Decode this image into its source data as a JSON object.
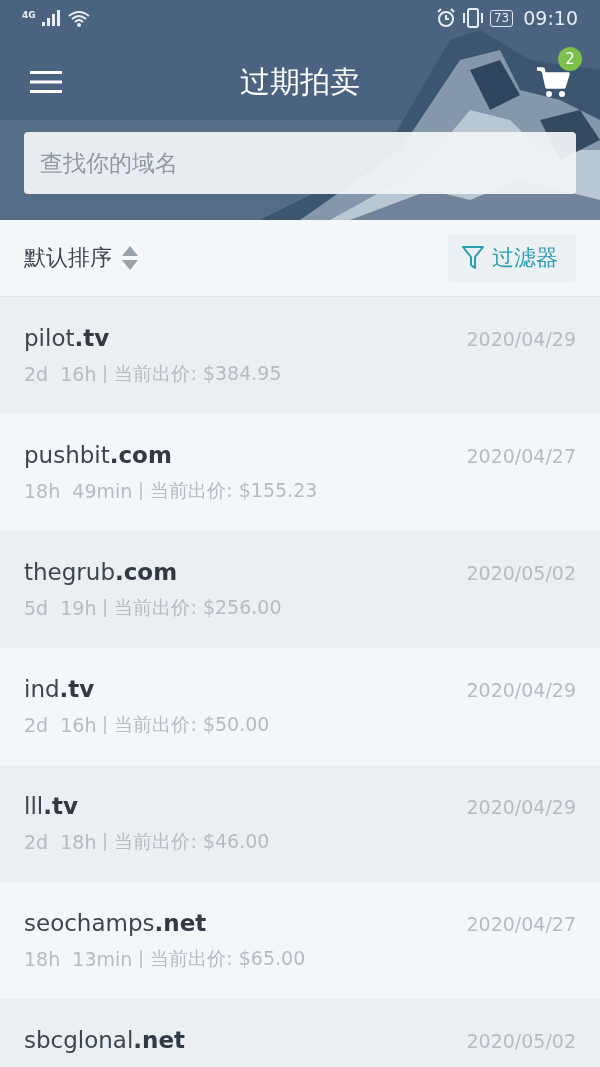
{
  "status_bar": {
    "network": "4G",
    "battery": "73",
    "time": "09:10"
  },
  "header": {
    "title": "过期拍卖",
    "cart_count": "2"
  },
  "search": {
    "placeholder": "查找你的域名"
  },
  "sort_bar": {
    "sort_label": "默认排序",
    "filter_label": "过滤器"
  },
  "auctions": [
    {
      "domain": "pilot**.tv**",
      "date": "2020/04/29",
      "time_left": "2d  16h",
      "bid": "当前出价: $384.95"
    },
    {
      "domain": "pushbit**.com**",
      "date": "2020/04/27",
      "time_left": "18h  49min",
      "bid": "当前出价: $155.23"
    },
    {
      "domain": "thegrub**.com**",
      "date": "2020/05/02",
      "time_left": "5d  19h",
      "bid": "当前出价: $256.00"
    },
    {
      "domain": "ind**.tv**",
      "date": "2020/04/29",
      "time_left": "2d  16h",
      "bid": "当前出价: $50.00"
    },
    {
      "domain": "lll**.tv**",
      "date": "2020/04/29",
      "time_left": "2d  18h",
      "bid": "当前出价: $46.00"
    },
    {
      "domain": "seochamps**.net**",
      "date": "2020/04/27",
      "time_left": "18h  13min",
      "bid": "当前出价: $65.00"
    },
    {
      "domain": "sbcglonal**.net**",
      "date": "2020/05/02"
    }
  ]
}
